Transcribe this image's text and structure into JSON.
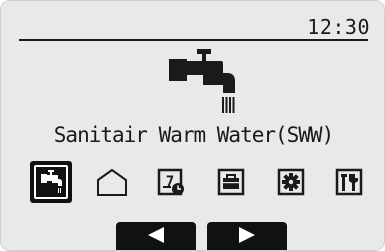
{
  "status_bar": {
    "time": "12:30"
  },
  "hero": {
    "icon": "tap-icon",
    "title": "Sanitair Warm Water(SWW)"
  },
  "menu": {
    "items": [
      {
        "name": "domestic-hot-water",
        "icon": "tap-icon",
        "selected": true
      },
      {
        "name": "heating",
        "icon": "house-icon",
        "selected": false
      },
      {
        "name": "schedule",
        "icon": "calendar-clock-icon",
        "selected": false
      },
      {
        "name": "holiday",
        "icon": "suitcase-icon",
        "selected": false
      },
      {
        "name": "settings",
        "icon": "gear-icon",
        "selected": false
      },
      {
        "name": "service",
        "icon": "tools-icon",
        "selected": false
      }
    ]
  },
  "navigation": {
    "prev_icon": "arrow-left-icon",
    "next_icon": "arrow-right-icon"
  },
  "colors": {
    "screen_bg": "#e9e9e9",
    "foreground": "#1a1a1a",
    "selected_bg": "#111111"
  }
}
